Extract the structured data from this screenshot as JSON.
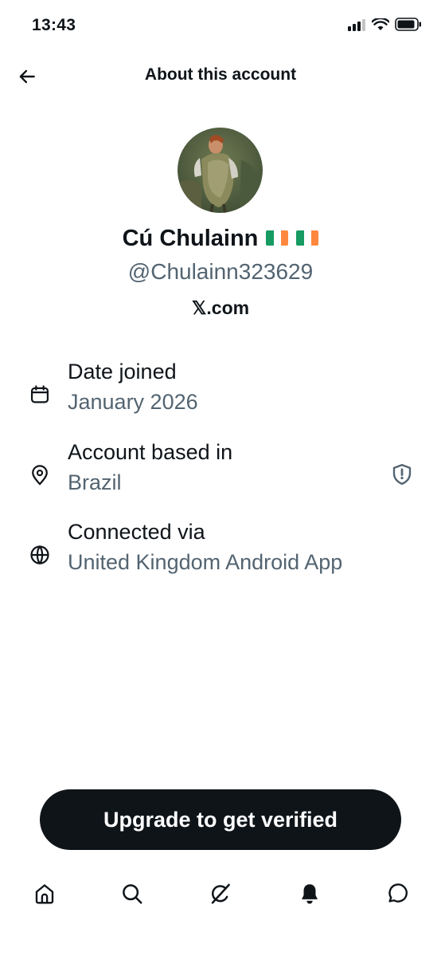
{
  "status_bar": {
    "time": "13:43",
    "icons": [
      "signal-icon",
      "wifi-icon",
      "battery-icon"
    ]
  },
  "header": {
    "title": "About this account",
    "back_icon": "back-arrow-icon"
  },
  "profile": {
    "display_name": "Cú Chulainn",
    "flags": [
      "Ireland flag emoji",
      "Ireland flag emoji"
    ],
    "handle": "@Chulainn323629",
    "site": "𝕏.com"
  },
  "info": [
    {
      "icon": "calendar-icon",
      "label": "Date joined",
      "value": "January 2026"
    },
    {
      "icon": "location-pin-icon",
      "label": "Account based in",
      "value": "Brazil",
      "extra_icon": "shield-icon"
    },
    {
      "icon": "globe-icon",
      "label": "Connected via",
      "value": "United Kingdom Android App"
    }
  ],
  "upgrade_button": {
    "label": "Upgrade to get verified"
  },
  "tab_bar": {
    "tabs": [
      "home-icon",
      "search-icon",
      "grok-icon",
      "notifications-bell-icon",
      "messages-icon"
    ]
  },
  "colors": {
    "text": "#0f1419",
    "secondary": "#536471",
    "button_bg": "#0f1419",
    "flag_green": "#169b62",
    "flag_white": "#ffffff",
    "flag_orange": "#ff883e"
  }
}
